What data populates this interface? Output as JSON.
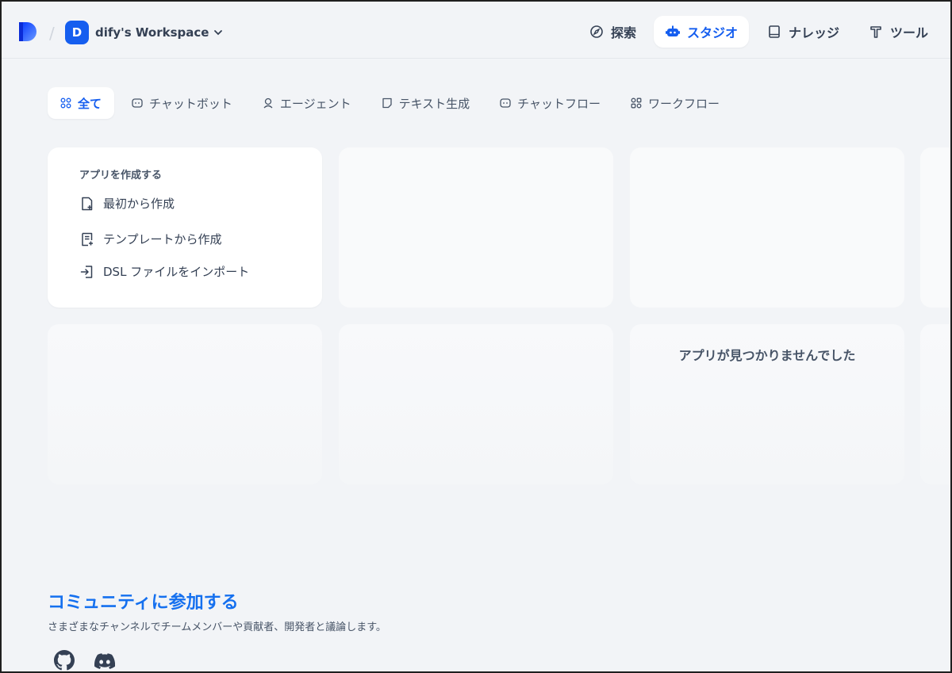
{
  "header": {
    "workspace_initial": "D",
    "workspace_name": "dify's Workspace",
    "nav": [
      {
        "label": "探索",
        "icon": "compass-icon"
      },
      {
        "label": "スタジオ",
        "icon": "robot-icon"
      },
      {
        "label": "ナレッジ",
        "icon": "book-icon"
      },
      {
        "label": "ツール",
        "icon": "tool-icon"
      }
    ]
  },
  "tabs": [
    {
      "label": "全て",
      "icon": "grid-icon"
    },
    {
      "label": "チャットボット",
      "icon": "chat-bubble-icon"
    },
    {
      "label": "エージェント",
      "icon": "agent-icon"
    },
    {
      "label": "テキスト生成",
      "icon": "document-icon"
    },
    {
      "label": "チャットフロー",
      "icon": "chat-bubble-icon"
    },
    {
      "label": "ワークフロー",
      "icon": "workflow-icon"
    }
  ],
  "create": {
    "title": "アプリを作成する",
    "items": [
      {
        "label": "最初から作成",
        "icon": "file-plus-icon"
      },
      {
        "label": "テンプレートから作成",
        "icon": "template-icon"
      },
      {
        "label": "DSL ファイルをインポート",
        "icon": "import-icon"
      }
    ]
  },
  "empty_message": "アプリが見つかりませんでした",
  "community": {
    "title": "コミュニティに参加する",
    "description": "さまざまなチャンネルでチームメンバーや貢献者、開発者と議論します。",
    "links": [
      "github-icon",
      "discord-icon"
    ]
  },
  "colors": {
    "accent": "#155eef",
    "community_title": "#1570ef",
    "background": "#f2f4f7"
  }
}
